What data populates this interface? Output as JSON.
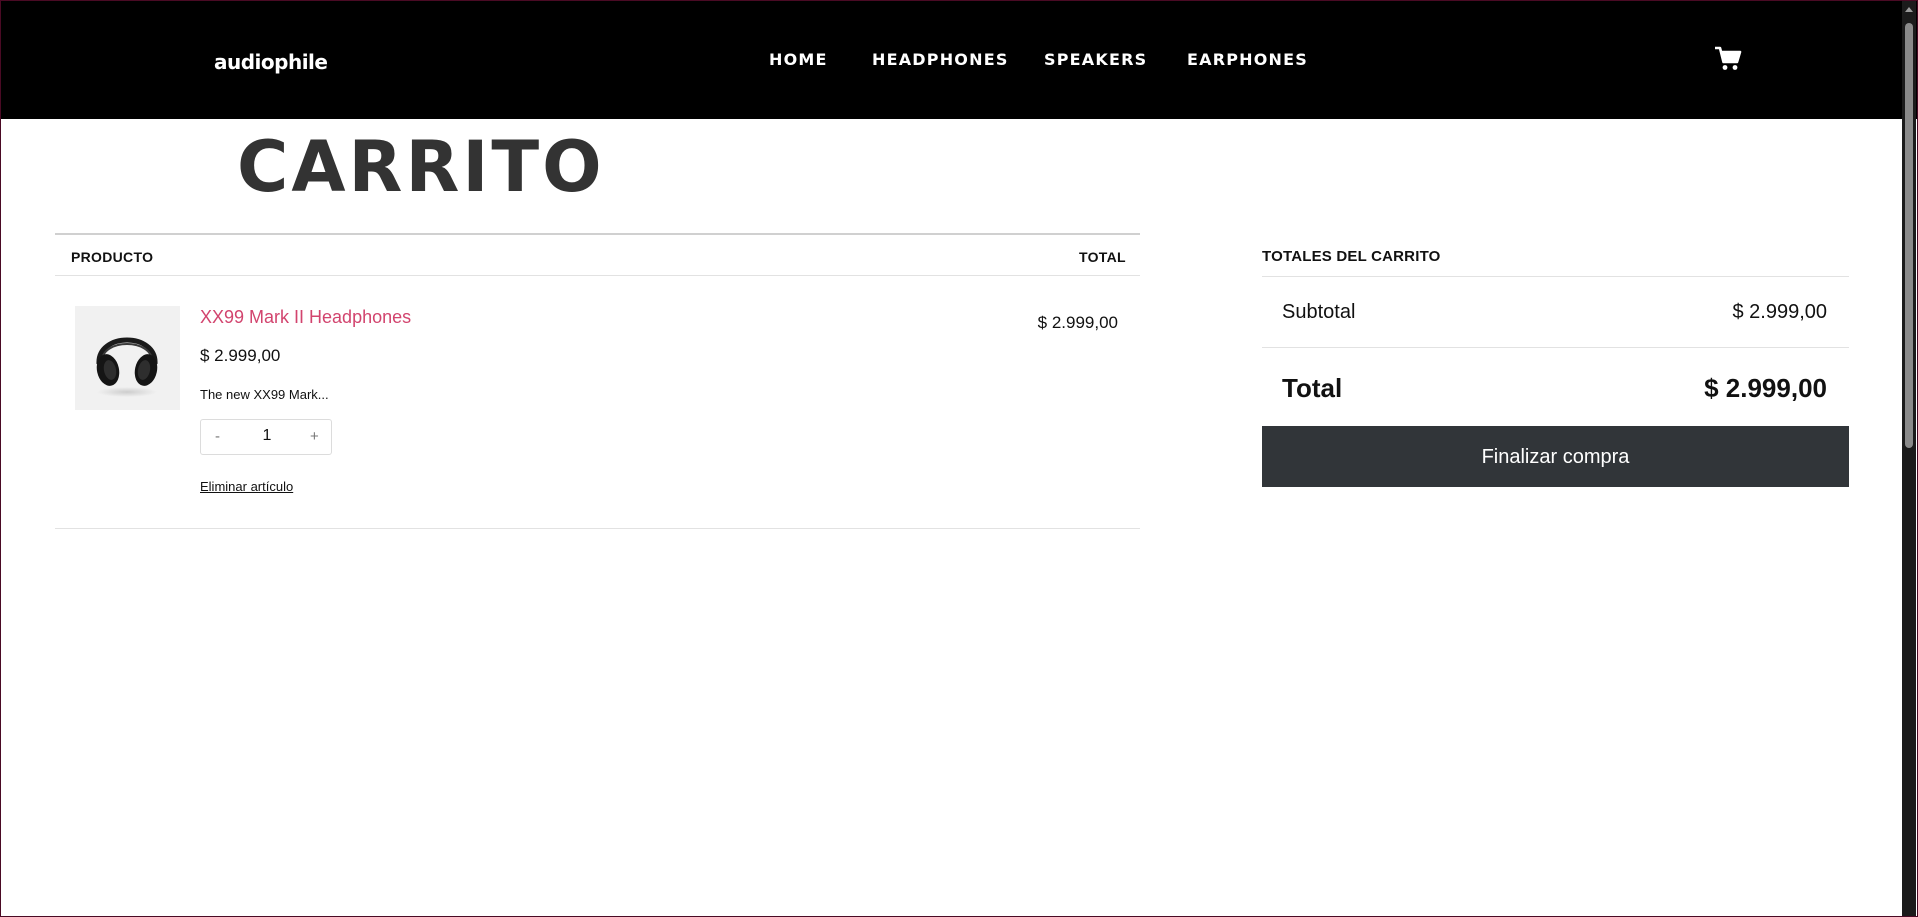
{
  "header": {
    "logo": "audiophile",
    "nav": [
      "HOME",
      "HEADPHONES",
      "SPEAKERS",
      "EARPHONES"
    ]
  },
  "page": {
    "title": "CARRITO"
  },
  "cart_table": {
    "col_product": "PRODUCTO",
    "col_total": "TOTAL",
    "items": [
      {
        "name": "XX99 Mark II Headphones",
        "price": "$ 2.999,00",
        "description": "The new XX99 Mark...",
        "qty_minus": "-",
        "quantity": "1",
        "qty_plus": "+",
        "remove_label": "Eliminar artículo",
        "line_total": "$ 2.999,00"
      }
    ]
  },
  "totals": {
    "title": "TOTALES DEL CARRITO",
    "subtotal_label": "Subtotal",
    "subtotal_value": "$ 2.999,00",
    "total_label": "Total",
    "total_value": "$ 2.999,00",
    "checkout_label": "Finalizar compra"
  },
  "colors": {
    "header_bg": "#000000",
    "accent_link": "#d2446e",
    "button_bg": "#313539"
  },
  "icons": {
    "cart": "shopping-cart-icon",
    "product_image": "headphones-image"
  }
}
